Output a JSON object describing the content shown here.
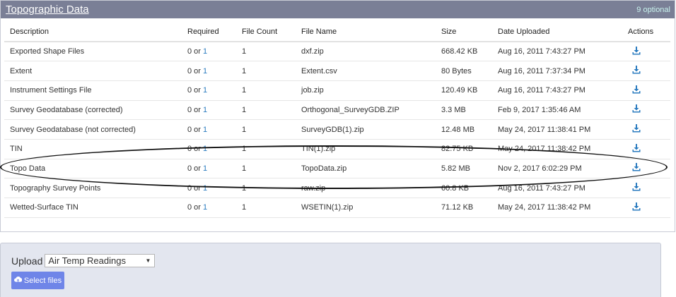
{
  "panel": {
    "title": "Topographic Data",
    "badge": "9 optional"
  },
  "table": {
    "headers": [
      "Description",
      "Required",
      "File Count",
      "File Name",
      "Size",
      "Date Uploaded",
      "Actions"
    ],
    "rows": [
      {
        "description": "Exported Shape Files",
        "required_a": "0 or ",
        "required_b": "1",
        "count": "1",
        "file": "dxf.zip",
        "size": "668.42 KB",
        "date": "Aug 16, 2011 7:43:27 PM"
      },
      {
        "description": "Extent",
        "required_a": "0 or ",
        "required_b": "1",
        "count": "1",
        "file": "Extent.csv",
        "size": "80 Bytes",
        "date": "Aug 16, 2011 7:37:34 PM"
      },
      {
        "description": "Instrument Settings File",
        "required_a": "0 or ",
        "required_b": "1",
        "count": "1",
        "file": "job.zip",
        "size": "120.49 KB",
        "date": "Aug 16, 2011 7:43:27 PM"
      },
      {
        "description": "Survey Geodatabase (corrected)",
        "required_a": "0 or ",
        "required_b": "1",
        "count": "1",
        "file": "Orthogonal_SurveyGDB.ZIP",
        "size": "3.3 MB",
        "date": "Feb 9, 2017 1:35:46 AM"
      },
      {
        "description": "Survey Geodatabase (not corrected)",
        "required_a": "0 or ",
        "required_b": "1",
        "count": "1",
        "file": "SurveyGDB(1).zip",
        "size": "12.48 MB",
        "date": "May 24, 2017 11:38:41 PM"
      },
      {
        "description": "TIN",
        "required_a": "0 or ",
        "required_b": "1",
        "count": "1",
        "file": "TIN(1).zip",
        "size": "82.75 KB",
        "date": "May 24, 2017 11:38:42 PM"
      },
      {
        "description": "Topo Data",
        "required_a": "0 or ",
        "required_b": "1",
        "count": "1",
        "file": "TopoData.zip",
        "size": "5.82 MB",
        "date": "Nov 2, 2017 6:02:29 PM"
      },
      {
        "description": "Topography Survey Points",
        "required_a": "0 or ",
        "required_b": "1",
        "count": "1",
        "file": "raw.zip",
        "size": "60.8 KB",
        "date": "Aug 16, 2011 7:43:27 PM"
      },
      {
        "description": "Wetted-Surface TIN",
        "required_a": "0 or ",
        "required_b": "1",
        "count": "1",
        "file": "WSETIN(1).zip",
        "size": "71.12 KB",
        "date": "May 24, 2017 11:38:42 PM"
      }
    ],
    "action_icon": "download-icon"
  },
  "upload": {
    "label": "Upload",
    "selected": "Air Temp Readings",
    "button": "Select files",
    "button_icon": "cloud-upload-icon"
  },
  "colors": {
    "header_bg": "#7a7f96",
    "link_blue": "#2a7bbf",
    "button_bg": "#6f85e8",
    "upload_bg": "#e3e6ef"
  }
}
